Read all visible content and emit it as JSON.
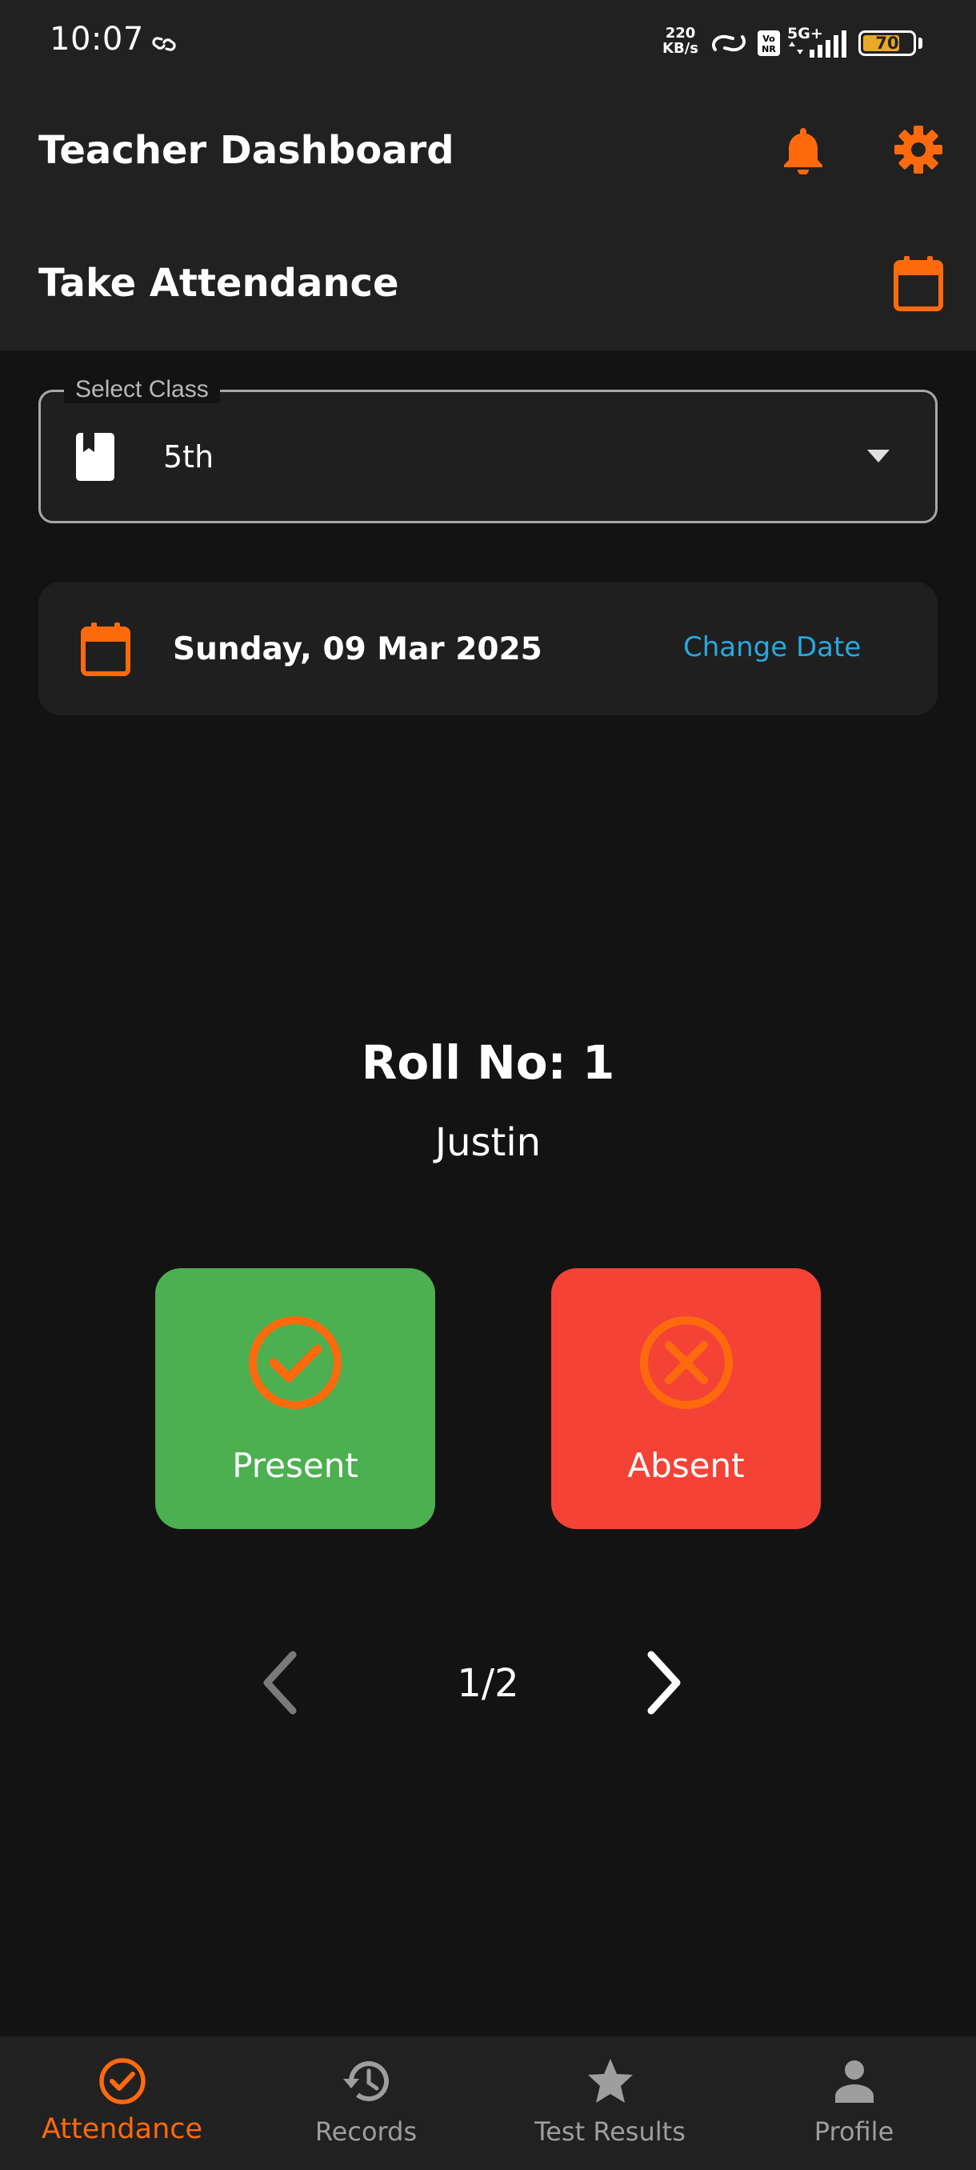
{
  "status_bar": {
    "time": "10:07",
    "network_speed_value": "220",
    "network_speed_unit": "KB/s",
    "network_type": "5G+",
    "battery_level": "70"
  },
  "app_bar": {
    "title": "Teacher Dashboard",
    "section_title": "Take Attendance",
    "icons": [
      "bell-icon",
      "gear-icon",
      "calendar-icon"
    ]
  },
  "select_class": {
    "label": "Select Class",
    "value": "5th"
  },
  "date_card": {
    "date": "Sunday, 09 Mar 2025",
    "change_label": "Change Date"
  },
  "student": {
    "roll_label": "Roll No: 1",
    "name": "Justin"
  },
  "actions": {
    "present_label": "Present",
    "absent_label": "Absent"
  },
  "pager": {
    "text": "1/2"
  },
  "bottom_nav": {
    "items": [
      {
        "label": "Attendance",
        "icon": "check-circle-icon",
        "active": true
      },
      {
        "label": "Records",
        "icon": "history-icon",
        "active": false
      },
      {
        "label": "Test Results",
        "icon": "star-icon",
        "active": false
      },
      {
        "label": "Profile",
        "icon": "person-icon",
        "active": false
      }
    ]
  },
  "colors": {
    "accent": "#fd6a0e",
    "present": "#4caf50",
    "absent": "#f44336",
    "link": "#29a8e0"
  }
}
